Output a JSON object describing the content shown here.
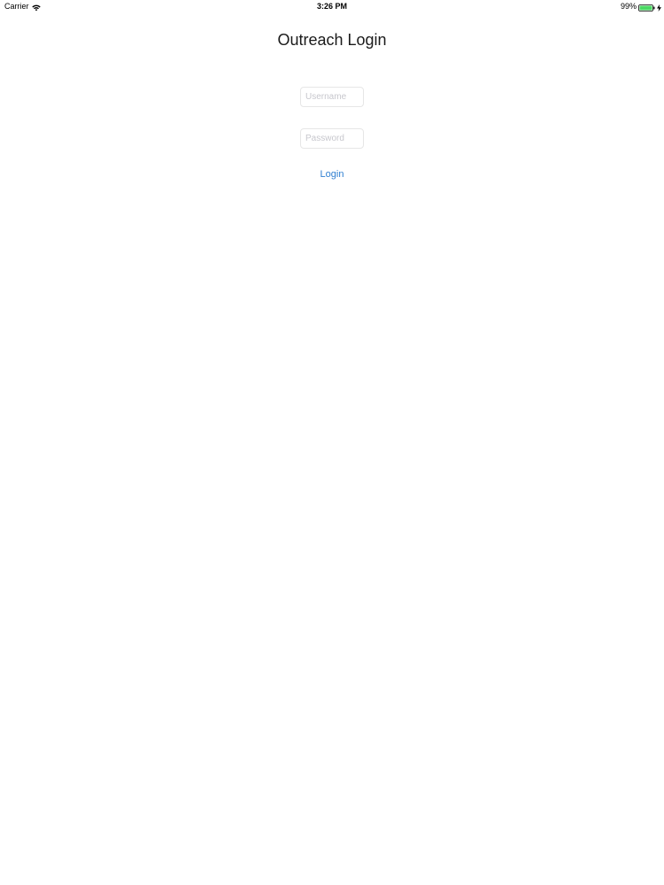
{
  "status_bar": {
    "carrier": "Carrier",
    "time": "3:26 PM",
    "battery_percent": "99%",
    "battery_color": "#4cd964"
  },
  "login": {
    "title": "Outreach Login",
    "username_placeholder": "Username",
    "username_value": "",
    "password_placeholder": "Password",
    "password_value": "",
    "login_label": "Login",
    "accent_color": "#2f7fd1"
  }
}
